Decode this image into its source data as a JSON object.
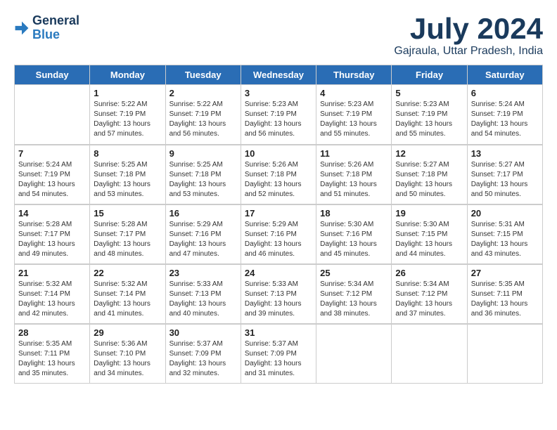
{
  "header": {
    "logo": {
      "line1": "General",
      "line2": "Blue"
    },
    "title": "July 2024",
    "location": "Gajraula, Uttar Pradesh, India"
  },
  "weekdays": [
    "Sunday",
    "Monday",
    "Tuesday",
    "Wednesday",
    "Thursday",
    "Friday",
    "Saturday"
  ],
  "weeks": [
    [
      {
        "day": "",
        "content": ""
      },
      {
        "day": "1",
        "content": "Sunrise: 5:22 AM\nSunset: 7:19 PM\nDaylight: 13 hours\nand 57 minutes."
      },
      {
        "day": "2",
        "content": "Sunrise: 5:22 AM\nSunset: 7:19 PM\nDaylight: 13 hours\nand 56 minutes."
      },
      {
        "day": "3",
        "content": "Sunrise: 5:23 AM\nSunset: 7:19 PM\nDaylight: 13 hours\nand 56 minutes."
      },
      {
        "day": "4",
        "content": "Sunrise: 5:23 AM\nSunset: 7:19 PM\nDaylight: 13 hours\nand 55 minutes."
      },
      {
        "day": "5",
        "content": "Sunrise: 5:23 AM\nSunset: 7:19 PM\nDaylight: 13 hours\nand 55 minutes."
      },
      {
        "day": "6",
        "content": "Sunrise: 5:24 AM\nSunset: 7:19 PM\nDaylight: 13 hours\nand 54 minutes."
      }
    ],
    [
      {
        "day": "7",
        "content": "Sunrise: 5:24 AM\nSunset: 7:19 PM\nDaylight: 13 hours\nand 54 minutes."
      },
      {
        "day": "8",
        "content": "Sunrise: 5:25 AM\nSunset: 7:18 PM\nDaylight: 13 hours\nand 53 minutes."
      },
      {
        "day": "9",
        "content": "Sunrise: 5:25 AM\nSunset: 7:18 PM\nDaylight: 13 hours\nand 53 minutes."
      },
      {
        "day": "10",
        "content": "Sunrise: 5:26 AM\nSunset: 7:18 PM\nDaylight: 13 hours\nand 52 minutes."
      },
      {
        "day": "11",
        "content": "Sunrise: 5:26 AM\nSunset: 7:18 PM\nDaylight: 13 hours\nand 51 minutes."
      },
      {
        "day": "12",
        "content": "Sunrise: 5:27 AM\nSunset: 7:18 PM\nDaylight: 13 hours\nand 50 minutes."
      },
      {
        "day": "13",
        "content": "Sunrise: 5:27 AM\nSunset: 7:17 PM\nDaylight: 13 hours\nand 50 minutes."
      }
    ],
    [
      {
        "day": "14",
        "content": "Sunrise: 5:28 AM\nSunset: 7:17 PM\nDaylight: 13 hours\nand 49 minutes."
      },
      {
        "day": "15",
        "content": "Sunrise: 5:28 AM\nSunset: 7:17 PM\nDaylight: 13 hours\nand 48 minutes."
      },
      {
        "day": "16",
        "content": "Sunrise: 5:29 AM\nSunset: 7:16 PM\nDaylight: 13 hours\nand 47 minutes."
      },
      {
        "day": "17",
        "content": "Sunrise: 5:29 AM\nSunset: 7:16 PM\nDaylight: 13 hours\nand 46 minutes."
      },
      {
        "day": "18",
        "content": "Sunrise: 5:30 AM\nSunset: 7:16 PM\nDaylight: 13 hours\nand 45 minutes."
      },
      {
        "day": "19",
        "content": "Sunrise: 5:30 AM\nSunset: 7:15 PM\nDaylight: 13 hours\nand 44 minutes."
      },
      {
        "day": "20",
        "content": "Sunrise: 5:31 AM\nSunset: 7:15 PM\nDaylight: 13 hours\nand 43 minutes."
      }
    ],
    [
      {
        "day": "21",
        "content": "Sunrise: 5:32 AM\nSunset: 7:14 PM\nDaylight: 13 hours\nand 42 minutes."
      },
      {
        "day": "22",
        "content": "Sunrise: 5:32 AM\nSunset: 7:14 PM\nDaylight: 13 hours\nand 41 minutes."
      },
      {
        "day": "23",
        "content": "Sunrise: 5:33 AM\nSunset: 7:13 PM\nDaylight: 13 hours\nand 40 minutes."
      },
      {
        "day": "24",
        "content": "Sunrise: 5:33 AM\nSunset: 7:13 PM\nDaylight: 13 hours\nand 39 minutes."
      },
      {
        "day": "25",
        "content": "Sunrise: 5:34 AM\nSunset: 7:12 PM\nDaylight: 13 hours\nand 38 minutes."
      },
      {
        "day": "26",
        "content": "Sunrise: 5:34 AM\nSunset: 7:12 PM\nDaylight: 13 hours\nand 37 minutes."
      },
      {
        "day": "27",
        "content": "Sunrise: 5:35 AM\nSunset: 7:11 PM\nDaylight: 13 hours\nand 36 minutes."
      }
    ],
    [
      {
        "day": "28",
        "content": "Sunrise: 5:35 AM\nSunset: 7:11 PM\nDaylight: 13 hours\nand 35 minutes."
      },
      {
        "day": "29",
        "content": "Sunrise: 5:36 AM\nSunset: 7:10 PM\nDaylight: 13 hours\nand 34 minutes."
      },
      {
        "day": "30",
        "content": "Sunrise: 5:37 AM\nSunset: 7:09 PM\nDaylight: 13 hours\nand 32 minutes."
      },
      {
        "day": "31",
        "content": "Sunrise: 5:37 AM\nSunset: 7:09 PM\nDaylight: 13 hours\nand 31 minutes."
      },
      {
        "day": "",
        "content": ""
      },
      {
        "day": "",
        "content": ""
      },
      {
        "day": "",
        "content": ""
      }
    ]
  ]
}
